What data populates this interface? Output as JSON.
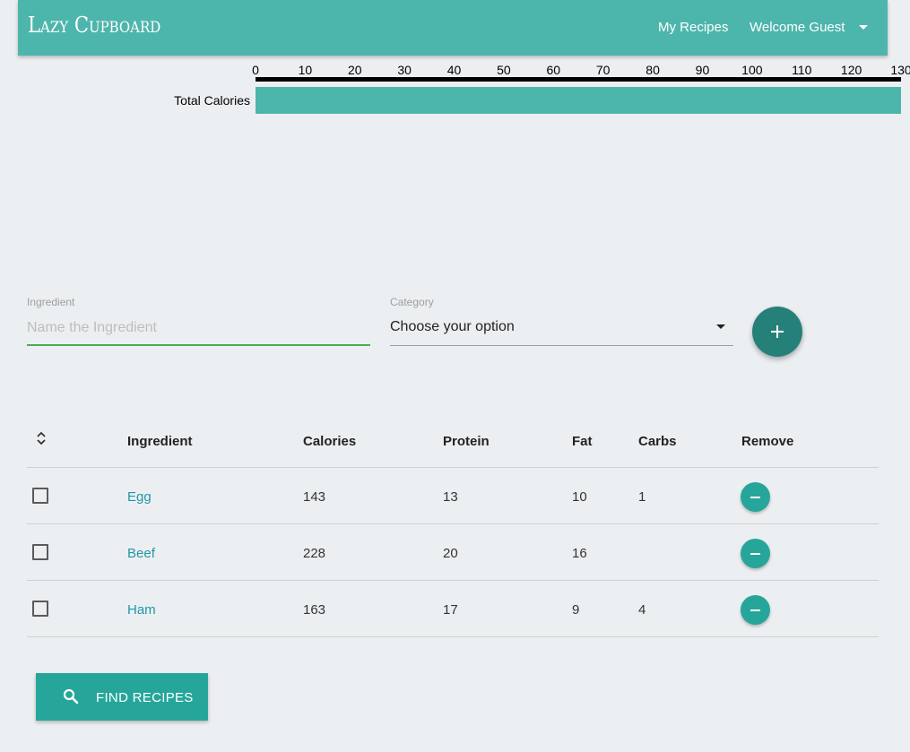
{
  "navbar": {
    "brand": "Lazy Cupboard",
    "my_recipes": "My Recipes",
    "welcome": "Welcome Guest",
    "caret_icon": "caret-down-icon"
  },
  "chart_data": {
    "type": "bar",
    "orientation": "horizontal",
    "categories": [
      "Total Calories"
    ],
    "values": [
      130
    ],
    "xticks": [
      0,
      10,
      20,
      30,
      40,
      50,
      60,
      70,
      80,
      90,
      100,
      110,
      120,
      130
    ],
    "xlim": [
      0,
      130
    ],
    "axis_position": "top",
    "bar_color": "#4db6ac",
    "grid": false
  },
  "form": {
    "ingredient_label": "Ingredient",
    "ingredient_placeholder": "Name the Ingredient",
    "ingredient_value": "",
    "category_label": "Category",
    "category_value": "Choose your option",
    "add_icon": "plus-icon"
  },
  "table": {
    "sort_icon": "collapse-icon",
    "headers": {
      "ingredient": "Ingredient",
      "calories": "Calories",
      "protein": "Protein",
      "fat": "Fat",
      "carbs": "Carbs",
      "remove": "Remove"
    },
    "rows": [
      {
        "checked": false,
        "ingredient": "Egg",
        "calories": "143",
        "protein": "13",
        "fat": "10",
        "carbs": "1"
      },
      {
        "checked": false,
        "ingredient": "Beef",
        "calories": "228",
        "protein": "20",
        "fat": "16",
        "carbs": ""
      },
      {
        "checked": false,
        "ingredient": "Ham",
        "calories": "163",
        "protein": "17",
        "fat": "9",
        "carbs": "4"
      }
    ],
    "remove_icon": "minus-icon"
  },
  "actions": {
    "find_label": "FIND RECIPES",
    "find_icon": "search-icon"
  },
  "colors": {
    "primary": "#4db6ac",
    "accent": "#26a69a",
    "dark_accent": "#26807a",
    "link": "#2196a8"
  }
}
